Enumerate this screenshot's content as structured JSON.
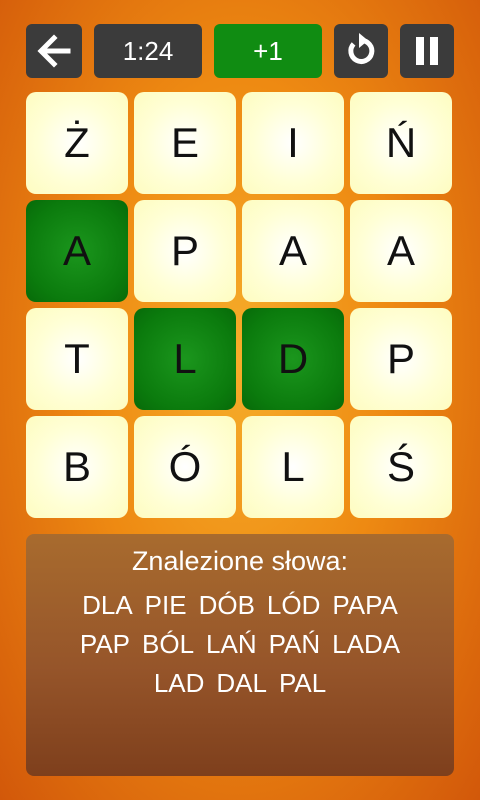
{
  "toolbar": {
    "timer": "1:24",
    "score": "+1",
    "score_color": "#108c12",
    "back_icon": "arrow-left-icon",
    "restart_icon": "restart-icon",
    "pause_icon": "pause-icon"
  },
  "board": {
    "rows": [
      [
        "Ż",
        "E",
        "I",
        "Ń"
      ],
      [
        "A",
        "P",
        "A",
        "A"
      ],
      [
        "T",
        "L",
        "D",
        "P"
      ],
      [
        "B",
        "Ó",
        "L",
        "Ś"
      ]
    ],
    "selected": [
      [
        1,
        0
      ],
      [
        2,
        1
      ],
      [
        2,
        2
      ]
    ],
    "selected_color": "#0b7b0d",
    "tile_color": "#ffffd6"
  },
  "found": {
    "title": "Znalezione słowa:",
    "rows": [
      [
        "DLA",
        "PIE",
        "DÓB",
        "LÓD",
        "PAPA"
      ],
      [
        "PAP",
        "BÓL",
        "LAŃ",
        "PAŃ",
        "LADA"
      ],
      [
        "LAD",
        "DAL",
        "PAL"
      ]
    ]
  }
}
